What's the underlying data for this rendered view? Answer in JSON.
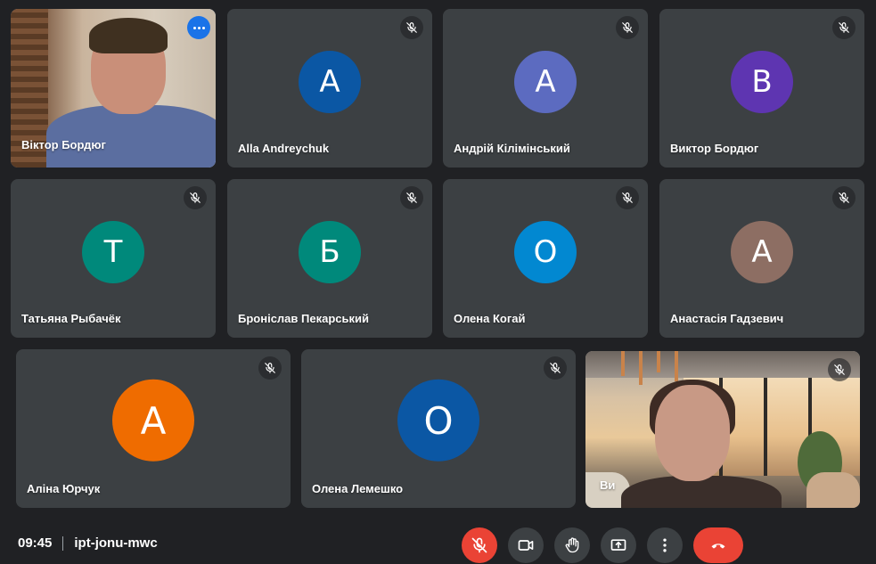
{
  "meeting": {
    "time": "09:45",
    "code": "ipt-jonu-mwc"
  },
  "participants": [
    {
      "name": "Віктор Бордюг",
      "video": true,
      "active": true
    },
    {
      "name": "Alla Andreychuk",
      "initial": "A",
      "color": "#0b57a4"
    },
    {
      "name": "Андрій Кілімінський",
      "initial": "А",
      "color": "#5c6bc0"
    },
    {
      "name": "Виктор Бордюг",
      "initial": "В",
      "color": "#5e35b1"
    },
    {
      "name": "Татьяна Рыбачёк",
      "initial": "Т",
      "color": "#00897b"
    },
    {
      "name": "Броніслав Пекарський",
      "initial": "Б",
      "color": "#00897b"
    },
    {
      "name": "Олена Когай",
      "initial": "О",
      "color": "#0288d1"
    },
    {
      "name": "Анастасія Гадзевич",
      "initial": "А",
      "color": "#8d6e63"
    },
    {
      "name": "Аліна Юрчук",
      "initial": "А",
      "color": "#ef6c00"
    },
    {
      "name": "Олена Лемешко",
      "initial": "О",
      "color": "#0b57a4"
    },
    {
      "name": "Ви",
      "video": true
    }
  ],
  "icons": {
    "mic_off": "mic-off-icon",
    "camera": "camera-icon",
    "raise_hand": "hand-icon",
    "present": "present-screen-icon",
    "more": "more-vert-icon",
    "end_call": "end-call-icon"
  }
}
